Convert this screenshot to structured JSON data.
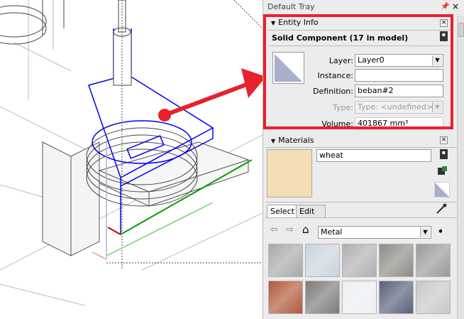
{
  "tray": {
    "title": "Default Tray"
  },
  "entity_info": {
    "header": "Entity Info",
    "heading": "Solid Component (17 in model)",
    "layer_label": "Layer:",
    "layer_value": "Layer0",
    "instance_label": "Instance:",
    "instance_value": "",
    "definition_label": "Definition:",
    "definition_value": "beban#2",
    "type_label": "Type:",
    "type_value": "Type: <undefined>",
    "volume_label": "Volume:",
    "volume_value": "401867 mm³"
  },
  "materials": {
    "header": "Materials",
    "name_value": "wheat",
    "swatch_color": "#f5ddb5",
    "tabs": [
      "Select",
      "Edit"
    ],
    "library_value": "Metal",
    "textures": [
      {
        "name": "metal-1",
        "color": "#a9a9a9"
      },
      {
        "name": "metal-2",
        "color": "#c9d3dd"
      },
      {
        "name": "metal-3",
        "color": "#b0b0b0"
      },
      {
        "name": "metal-4",
        "color": "#8d8d85"
      },
      {
        "name": "metal-5",
        "color": "#9a9a98"
      },
      {
        "name": "metal-6",
        "color": "#b0593a"
      },
      {
        "name": "metal-7",
        "color": "#7a7b78"
      },
      {
        "name": "metal-8",
        "color": "#eceff3"
      },
      {
        "name": "metal-9",
        "color": "#566178"
      },
      {
        "name": "metal-10",
        "color": "#c8c8c8"
      }
    ]
  },
  "colors": {
    "highlight": "#e8212c",
    "selection": "#0000ee",
    "axis_green": "#00a000",
    "axis_red": "#cc0000"
  },
  "icons": [
    "pin-icon",
    "close-icon",
    "component-preview-icon",
    "back-icon",
    "forward-icon",
    "home-icon",
    "eyedropper-icon",
    "details-icon",
    "create-material-icon",
    "paint-bucket-icon",
    "default-material-icon"
  ]
}
